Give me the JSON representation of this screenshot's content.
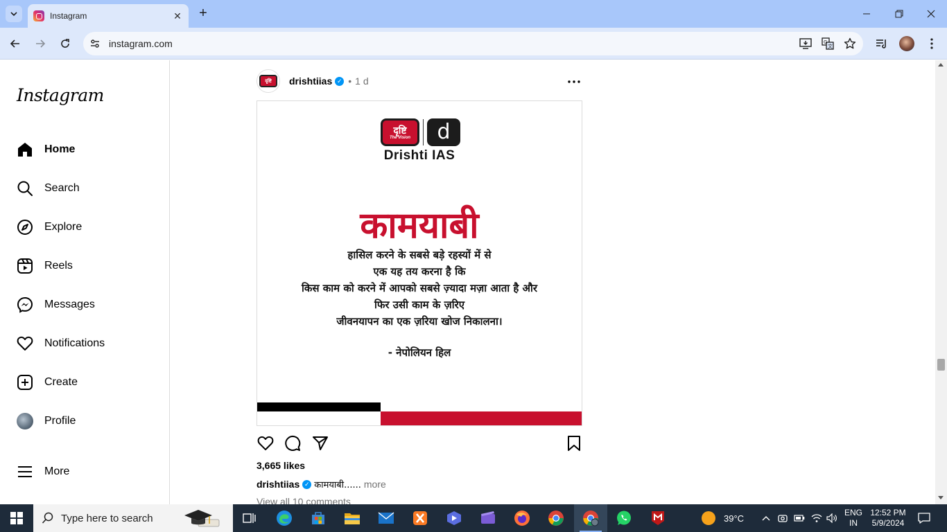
{
  "browser": {
    "tab_title": "Instagram",
    "new_tab": "+",
    "url": "instagram.com"
  },
  "instagram": {
    "logo": "Instagram",
    "nav": [
      {
        "label": "Home",
        "icon": "home-icon"
      },
      {
        "label": "Search",
        "icon": "search-icon"
      },
      {
        "label": "Explore",
        "icon": "explore-icon"
      },
      {
        "label": "Reels",
        "icon": "reels-icon"
      },
      {
        "label": "Messages",
        "icon": "messenger-icon"
      },
      {
        "label": "Notifications",
        "icon": "heart-icon"
      },
      {
        "label": "Create",
        "icon": "create-icon"
      },
      {
        "label": "Profile",
        "icon": "avatar"
      }
    ],
    "more": "More"
  },
  "post": {
    "username": "drishtiias",
    "separator": "•",
    "time": "1 d",
    "brand_logo_text": "दृष्टि",
    "brand_logo_sub": "The Vision",
    "brand_logo_d": "d",
    "brand_name": "Drishti IAS",
    "headline": "कामयाबी",
    "quote_lines": [
      "हासिल करने के सबसे बड़े रहस्यों में से",
      "एक यह तय करना है कि",
      "किस काम को करने में आपको सबसे ज़्यादा मज़ा आता है और",
      "फिर उसी काम के ज़रिए",
      "जीवनयापन का एक ज़रिया खोज निकालना।"
    ],
    "quote_author": "- नेपोलियन हिल",
    "likes": "3,665 likes",
    "caption_user": "drishtiias",
    "caption_text": "कामयाबी......",
    "caption_more": "more",
    "comments_link": "View all 10 comments"
  },
  "taskbar": {
    "search_placeholder": "Type here to search",
    "weather": "39°C",
    "lang_line1": "ENG",
    "lang_line2": "IN",
    "time": "12:52 PM",
    "date": "5/9/2024"
  },
  "colors": {
    "tabbar": "#a8c7fa",
    "toolbar": "#dde8fb",
    "drishti_red": "#c8102e",
    "taskbar": "#1e2b3a",
    "verified": "#0095f6"
  }
}
